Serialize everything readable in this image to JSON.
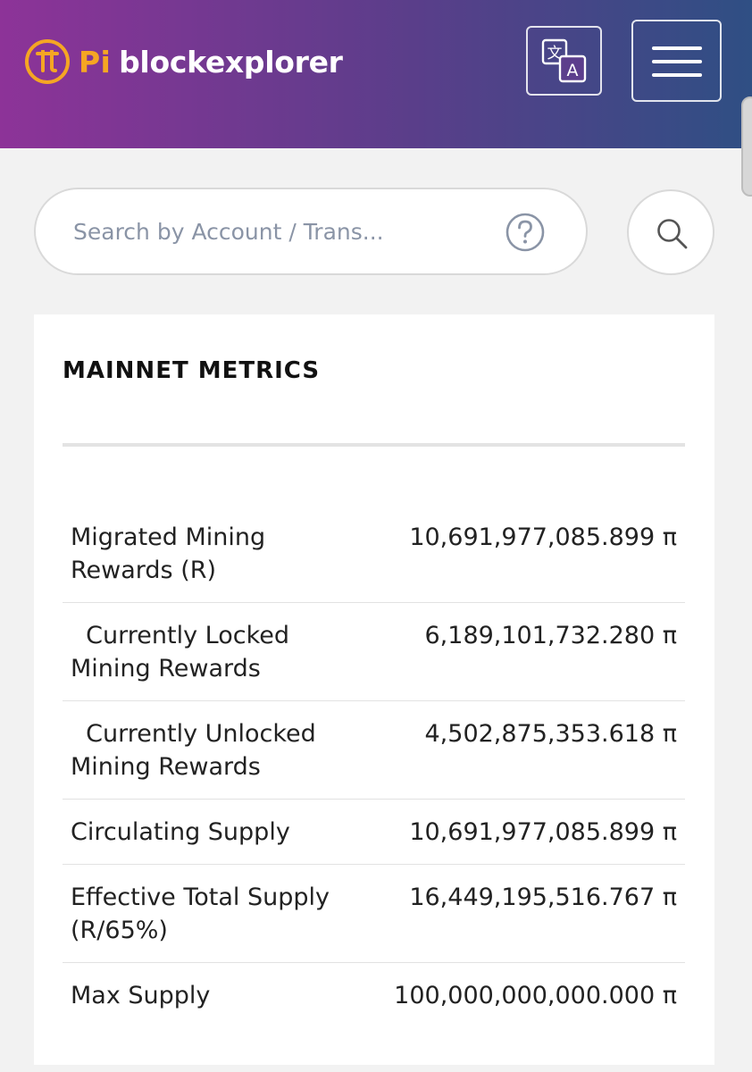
{
  "header": {
    "brand_pi": "Pi",
    "brand_name": "blockexplorer",
    "colors": {
      "gradient_start": "#8d3398",
      "gradient_end": "#2f4f84",
      "brand_orange": "#f5a623"
    },
    "translate_icon": "translate-icon",
    "menu_icon": "hamburger-menu-icon"
  },
  "search": {
    "placeholder": "Search by Account / Trans...",
    "value": "",
    "help_icon": "question-circle-icon",
    "submit_icon": "search-icon"
  },
  "metrics": {
    "title": "MAINNET METRICS",
    "rows": [
      {
        "label": "Migrated Mining Rewards (R)",
        "value": "10,691,977,085.899 π"
      },
      {
        "label": "  Currently Locked Mining Rewards",
        "value": "6,189,101,732.280 π"
      },
      {
        "label": "  Currently Unlocked Mining Rewards",
        "value": "4,502,875,353.618 π"
      },
      {
        "label": "Circulating Supply",
        "value": "10,691,977,085.899 π"
      },
      {
        "label": "Effective Total Supply (R/65%)",
        "value": "16,449,195,516.767 π"
      },
      {
        "label": "Max Supply",
        "value": "100,000,000,000.000 π"
      }
    ]
  }
}
